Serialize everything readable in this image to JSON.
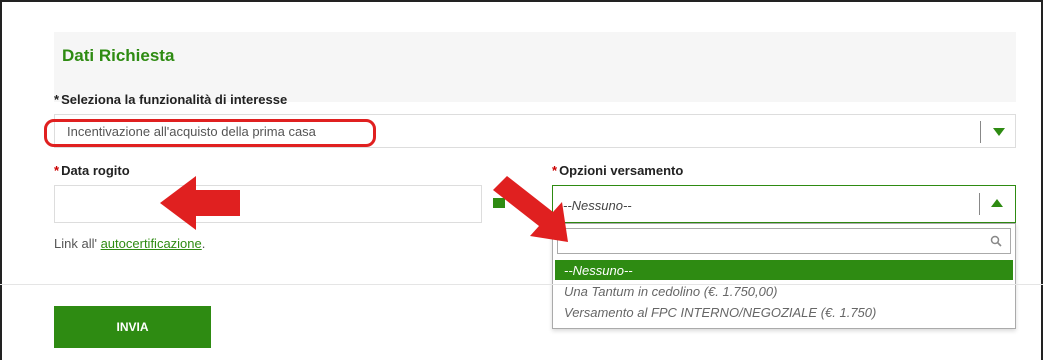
{
  "section": {
    "title": "Dati Richiesta"
  },
  "funzionalita": {
    "label": "Seleziona la funzionalità di interesse",
    "required_mark": "*",
    "value": "Incentivazione all'acquisto della prima casa"
  },
  "data_rogito": {
    "label": "Data rogito",
    "required_mark": "*",
    "value": ""
  },
  "link_line": {
    "prefix": "Link all'",
    "link_text": "autocertificazione",
    "suffix": "."
  },
  "opzioni": {
    "label": "Opzioni versamento",
    "required_mark": "*",
    "value": "--Nessuno--",
    "search_value": "",
    "options": [
      "--Nessuno--",
      "Una Tantum in cedolino (€. 1.750,00)",
      "Versamento al FPC INTERNO/NEGOZIALE (€. 1.750)"
    ],
    "selected_index": 0
  },
  "submit": {
    "label": "INVIA"
  },
  "colors": {
    "accent": "#2e8b12",
    "required": "#cc0000",
    "annotation": "#e02020"
  },
  "icons": [
    "chevron-down-icon",
    "chevron-up-icon",
    "calendar-icon",
    "search-icon",
    "arrow-annotation-icon"
  ]
}
